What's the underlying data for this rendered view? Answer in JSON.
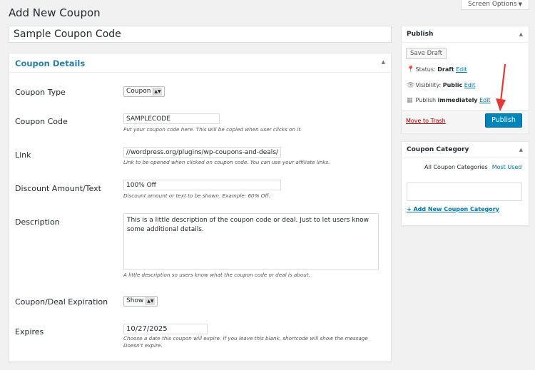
{
  "page": {
    "title": "Add New Coupon",
    "screen_options": "Screen Options",
    "post_title_value": "Sample Coupon Code"
  },
  "details": {
    "heading": "Coupon Details",
    "type": {
      "label": "Coupon Type",
      "value": "Coupon"
    },
    "code": {
      "label": "Coupon Code",
      "value": "SAMPLECODE",
      "hint": "Put your coupon code here. This will be copied when user clicks on it."
    },
    "link": {
      "label": "Link",
      "value": "//wordpress.org/plugins/wp-coupons-and-deals/",
      "hint": "Link to be opened when clicked on coupon code. You can use your affiliate links."
    },
    "discount": {
      "label": "Discount Amount/Text",
      "value": "100% Off",
      "hint": "Discount amount or text to be shown. Example: 60% Off."
    },
    "description": {
      "label": "Description",
      "value": "This is a little description of the coupon code or deal. Just to let users know some additional details.",
      "hint": "A little description so users know what the coupon code or deal is about."
    },
    "expiration": {
      "label": "Coupon/Deal Expiration",
      "value": "Show"
    },
    "expires": {
      "label": "Expires",
      "value": "10/27/2025",
      "hint": "Choose a date this coupon will expire. If you leave this blank, shortcode will show the message Doesn't expire."
    }
  },
  "publish": {
    "heading": "Publish",
    "save_draft": "Save Draft",
    "status_label": "Status:",
    "status_value": "Draft",
    "visibility_label": "Visibility:",
    "visibility_value": "Public",
    "publish_label": "Publish",
    "publish_value": "immediately",
    "edit": "Edit",
    "trash": "Move to Trash",
    "publish_button": "Publish"
  },
  "category": {
    "heading": "Coupon Category",
    "tab_all": "All Coupon Categories",
    "tab_most": "Most Used",
    "add_new": "+ Add New Coupon Category"
  },
  "colors": {
    "accent": "#0085ba",
    "heading_link": "#2a7ea8",
    "trash": "#a00",
    "annotation_arrow": "#e53935"
  }
}
